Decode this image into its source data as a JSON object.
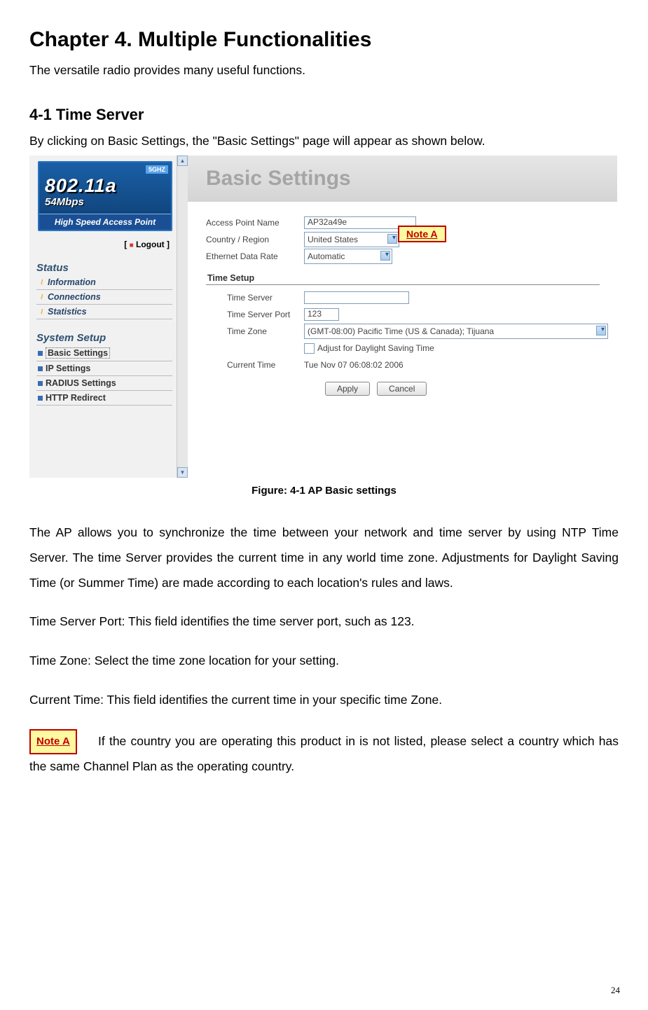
{
  "chapter_title": "Chapter 4.    Multiple Functionalities",
  "intro": "The versatile radio provides many useful functions.",
  "section_title": "4-1    Time Server",
  "section_intro": "By clicking on Basic Settings, the \"Basic Settings\" page will appear as shown below.",
  "caption": "Figure: 4-1 AP Basic settings",
  "para1": "The AP allows you to synchronize the time between your network and time server by using NTP Time Server. The time Server provides the current time in any world time zone. Adjustments for Daylight Saving Time (or Summer Time) are made according to each location's rules and laws.",
  "para2": "Time Server Port: This field identifies the time server port, such as 123.",
  "para3": "Time Zone: Select the time zone location for your setting.",
  "para4": "Current Time: This field identifies the current time in your specific time Zone.",
  "noteA_label": "Note A",
  "noteA_text": "   If the country you are operating this product in is not listed,  please select a country which has the same Channel Plan as the operating country.",
  "page_number": "24",
  "screenshot": {
    "logo": {
      "five_g": "5GHZ",
      "title": "802.11a",
      "sub": "54Mbps",
      "bar": "High Speed Access Point"
    },
    "logout": "Logout",
    "menu": {
      "status_header": "Status",
      "status_items": [
        "Information",
        "Connections",
        "Statistics"
      ],
      "setup_header": "System Setup",
      "setup_items": [
        "Basic Settings",
        "IP Settings",
        "RADIUS Settings",
        "HTTP Redirect"
      ]
    },
    "page_header": "Basic Settings",
    "fields": {
      "ap_name_label": "Access Point Name",
      "ap_name_value": "AP32a49e",
      "country_label": "Country / Region",
      "country_value": "United States",
      "edr_label": "Ethernet Data Rate",
      "edr_value": "Automatic",
      "time_setup": "Time Setup",
      "ts_label": "Time Server",
      "ts_value": "",
      "tsp_label": "Time Server Port",
      "tsp_value": "123",
      "tz_label": "Time Zone",
      "tz_value": "(GMT-08:00) Pacific Time (US & Canada); Tijuana",
      "dst_label": "Adjust for Daylight Saving Time",
      "ct_label": "Current Time",
      "ct_value": "Tue Nov 07 06:08:02 2006",
      "apply": "Apply",
      "cancel": "Cancel"
    }
  }
}
